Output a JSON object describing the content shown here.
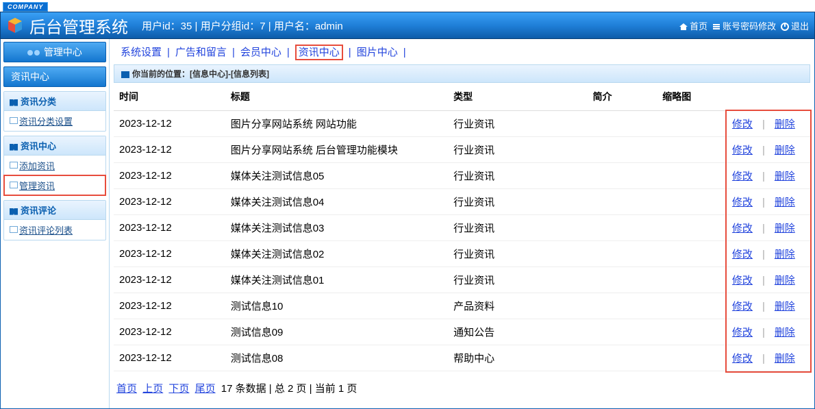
{
  "company_badge": "COMPANY",
  "header": {
    "title": "后台管理系统",
    "user_info": "用户id：35 | 用户分组id：7 | 用户名：admin",
    "links": {
      "home": "首页",
      "password": "账号密码修改",
      "logout": "退出"
    }
  },
  "sidebar": {
    "header": "管理中心",
    "sections": [
      {
        "title": "资讯中心",
        "type": "header-bar"
      },
      {
        "title": "资讯分类",
        "links": [
          {
            "label": "资讯分类设置",
            "hl": false
          }
        ]
      },
      {
        "title": "资讯中心",
        "links": [
          {
            "label": "添加资讯",
            "hl": false
          },
          {
            "label": "管理资讯",
            "hl": true
          }
        ]
      },
      {
        "title": "资讯评论",
        "links": [
          {
            "label": "资讯评论列表",
            "hl": false
          }
        ]
      }
    ]
  },
  "tabs": [
    {
      "label": "系统设置",
      "active": false
    },
    {
      "label": "广告和留言",
      "active": false
    },
    {
      "label": "会员中心",
      "active": false
    },
    {
      "label": "资讯中心",
      "active": true
    },
    {
      "label": "图片中心",
      "active": false
    }
  ],
  "breadcrumb": "你当前的位置：[信息中心]-[信息列表]",
  "table": {
    "headers": [
      "时间",
      "标题",
      "类型",
      "简介",
      "缩略图",
      ""
    ],
    "actions": {
      "edit": "修改",
      "delete": "删除"
    },
    "rows": [
      {
        "time": "2023-12-12",
        "title": "图片分享网站系统 网站功能",
        "type": "行业资讯",
        "intro": "",
        "thumb": ""
      },
      {
        "time": "2023-12-12",
        "title": "图片分享网站系统 后台管理功能模块",
        "type": "行业资讯",
        "intro": "",
        "thumb": ""
      },
      {
        "time": "2023-12-12",
        "title": "媒体关注测试信息05",
        "type": "行业资讯",
        "intro": "",
        "thumb": ""
      },
      {
        "time": "2023-12-12",
        "title": "媒体关注测试信息04",
        "type": "行业资讯",
        "intro": "",
        "thumb": ""
      },
      {
        "time": "2023-12-12",
        "title": "媒体关注测试信息03",
        "type": "行业资讯",
        "intro": "",
        "thumb": ""
      },
      {
        "time": "2023-12-12",
        "title": "媒体关注测试信息02",
        "type": "行业资讯",
        "intro": "",
        "thumb": ""
      },
      {
        "time": "2023-12-12",
        "title": "媒体关注测试信息01",
        "type": "行业资讯",
        "intro": "",
        "thumb": ""
      },
      {
        "time": "2023-12-12",
        "title": "测试信息10",
        "type": "产品资料",
        "intro": "",
        "thumb": ""
      },
      {
        "time": "2023-12-12",
        "title": "测试信息09",
        "type": "通知公告",
        "intro": "",
        "thumb": ""
      },
      {
        "time": "2023-12-12",
        "title": "测试信息08",
        "type": "帮助中心",
        "intro": "",
        "thumb": ""
      }
    ]
  },
  "pagination": {
    "links": {
      "first": "首页",
      "prev": "上页",
      "next": "下页",
      "last": "尾页"
    },
    "info": "17 条数据 | 总 2 页 | 当前 1 页"
  }
}
